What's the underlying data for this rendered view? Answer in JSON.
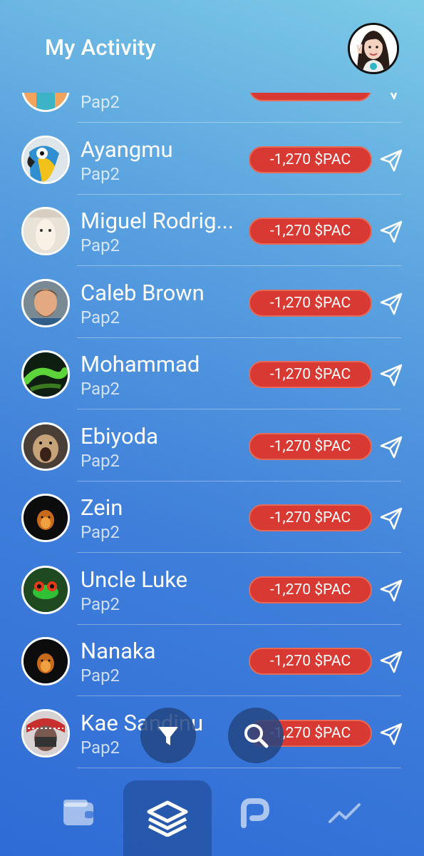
{
  "header": {
    "title": "My Activity"
  },
  "activities": [
    {
      "name": "",
      "sub": "Pap2",
      "amount": "",
      "av": "av0"
    },
    {
      "name": "Ayangmu",
      "sub": "Pap2",
      "amount": "-1,270 $PAC",
      "av": "av1"
    },
    {
      "name": "Miguel Rodrig...",
      "sub": "Pap2",
      "amount": "-1,270 $PAC",
      "av": "av2"
    },
    {
      "name": "Caleb Brown",
      "sub": "Pap2",
      "amount": "-1,270 $PAC",
      "av": "av3"
    },
    {
      "name": "Mohammad",
      "sub": "Pap2",
      "amount": "-1,270 $PAC",
      "av": "av4"
    },
    {
      "name": "Ebiyoda",
      "sub": "Pap2",
      "amount": "-1,270 $PAC",
      "av": "av5"
    },
    {
      "name": "Zein",
      "sub": "Pap2",
      "amount": "-1,270 $PAC",
      "av": "av6"
    },
    {
      "name": "Uncle Luke",
      "sub": "Pap2",
      "amount": "-1,270 $PAC",
      "av": "av7"
    },
    {
      "name": "Nanaka",
      "sub": "Pap2",
      "amount": "-1,270 $PAC",
      "av": "av6"
    },
    {
      "name": "Kae Sandinu",
      "sub": "Pap2",
      "amount": "-1,270 $PAC",
      "av": "av9"
    }
  ],
  "nav": [
    "wallet-icon",
    "layers-icon",
    "pac-logo-icon",
    "trend-icon"
  ],
  "colors": {
    "amount_bg": "#d83a33",
    "fab_bg": "#23467f"
  }
}
